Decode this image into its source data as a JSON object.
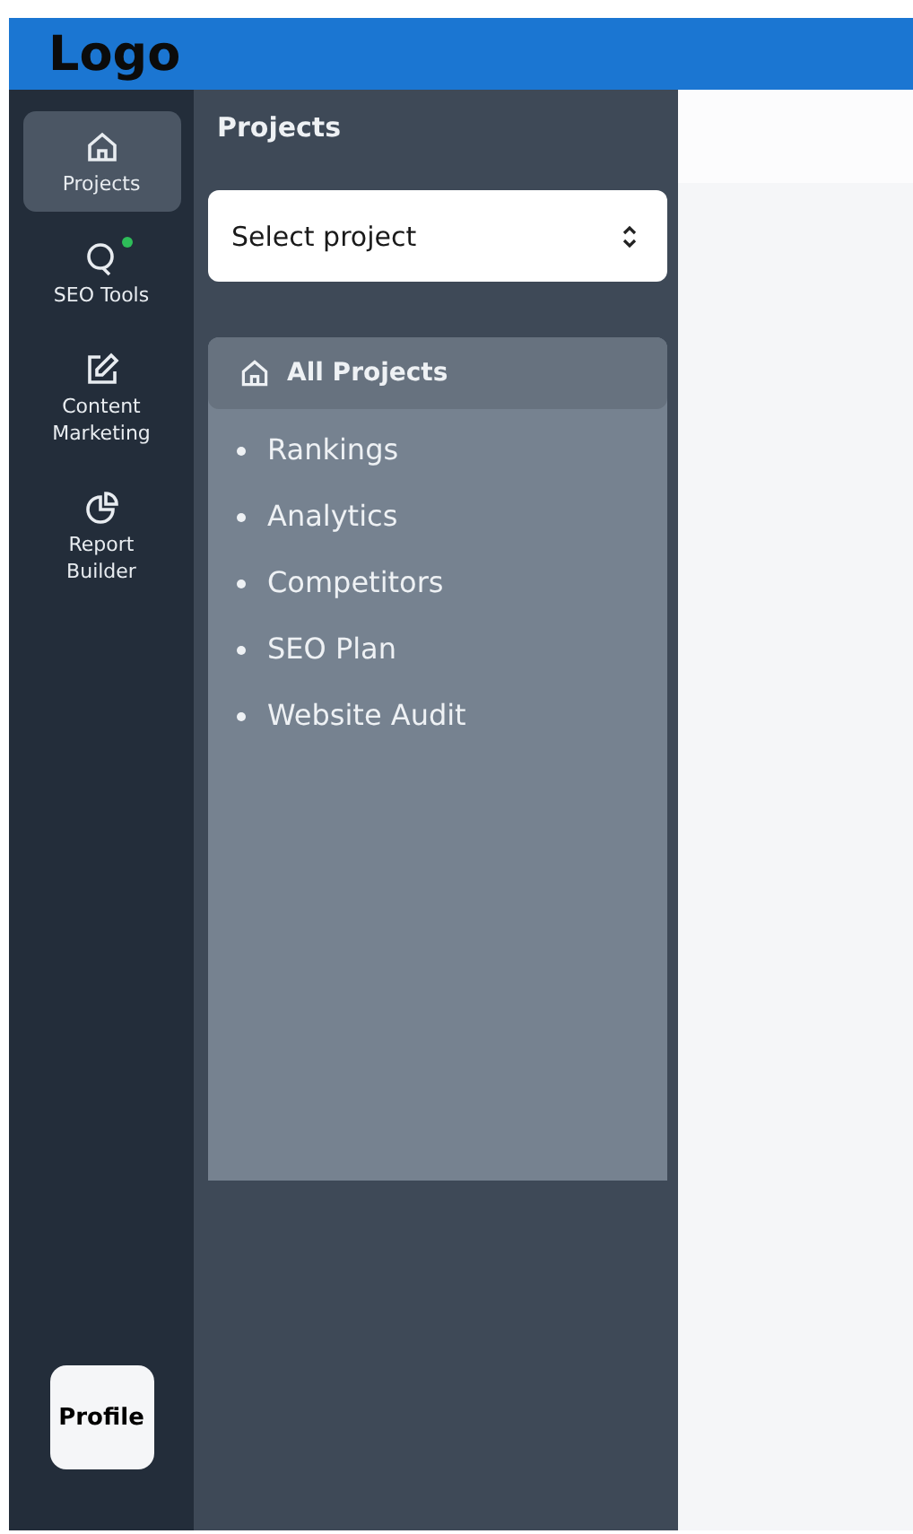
{
  "header": {
    "logo": "Logo"
  },
  "nav": [
    {
      "label": "Projects",
      "selected": true,
      "notification": false
    },
    {
      "label": "SEO Tools",
      "selected": false,
      "notification": true
    },
    {
      "label": "Content Marketing",
      "selected": false,
      "notification": false
    },
    {
      "label": "Report Builder",
      "selected": false,
      "notification": false
    }
  ],
  "profile": {
    "label": "Profile"
  },
  "panel": {
    "title": "Projects",
    "select": {
      "value": "Select project"
    },
    "group": {
      "title": "All Projects",
      "items": [
        "Rankings",
        "Analytics",
        "Competitors",
        "SEO Plan",
        "Website Audit"
      ]
    }
  }
}
